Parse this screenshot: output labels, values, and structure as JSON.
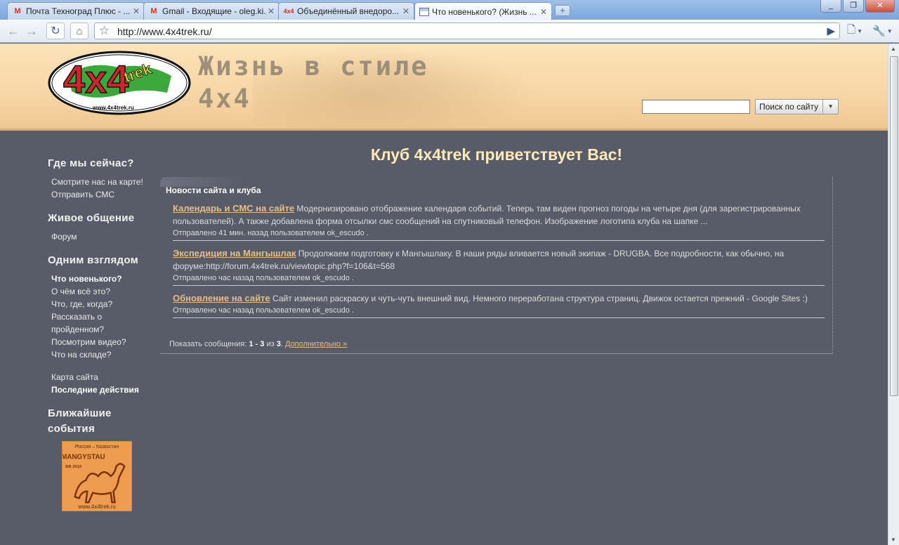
{
  "browser": {
    "tabs": [
      {
        "title": "Почта Техноград Плюс - ...",
        "icon": "gmail-icon"
      },
      {
        "title": "Gmail - Входящие - oleg.ki...",
        "icon": "gmail-icon"
      },
      {
        "title": "Объединённый внедоро...",
        "icon": "4x4trek-favicon"
      },
      {
        "title": "Что новенького? (Жизнь ...",
        "icon": "google-sites-icon"
      }
    ],
    "new_tab": "+",
    "url": "http://www.4x4trek.ru/"
  },
  "header": {
    "tagline_line1": "Жизнь в стиле",
    "tagline_line2": "4x4",
    "logo_text": "4x4trek",
    "logo_url": "www.4x4trek.ru",
    "search_button": "Поиск по сайту",
    "search_value": ""
  },
  "sidebar": {
    "sections": [
      {
        "title": "Где мы сейчас?",
        "items": [
          {
            "label": "Смотрите нас на карте!",
            "bold": false
          },
          {
            "label": "Отправить СМС",
            "bold": false
          }
        ]
      },
      {
        "title": "Живое общение",
        "items": [
          {
            "label": "Форум",
            "bold": false
          }
        ]
      },
      {
        "title": "Одним взглядом",
        "items": [
          {
            "label": "Что новенького?",
            "bold": true
          },
          {
            "label": "О чём всё это?",
            "bold": false
          },
          {
            "label": "Что, где, когда?",
            "bold": false
          },
          {
            "label": "Рассказать о пройденном?",
            "bold": false
          },
          {
            "label": "Посмотрим видео?",
            "bold": false
          },
          {
            "label": "Что на складе?",
            "bold": false
          }
        ]
      },
      {
        "title": "",
        "items": [
          {
            "label": "Карта сайта",
            "bold": false
          },
          {
            "label": "Последние действия",
            "bold": true
          }
        ]
      }
    ],
    "events_title": "Ближайшие события",
    "event_banner": {
      "line1": "Россия – Казахстан",
      "line2": "MANGYSTAU",
      "line3": "БВ 2010",
      "line4": "www.4x4trek.ru"
    }
  },
  "main": {
    "title": "Клуб 4x4trek приветствует Вас!",
    "news_heading": "Новости сайта и клуба",
    "news": [
      {
        "title": "Календарь и СМС на сайте",
        "body": "Модернизировано отображение календаря событий. Теперь там виден прогноз погоды на четыре дня (для зарегистрированных пользователей). А также добавлена форма отсылки смс сообщений на спутниковый телефон. Изображение логотипа клуба на шапке ...",
        "meta": "Отправлено 41 мин. назад пользователем ok_escudo ."
      },
      {
        "title": "Экспедиция на Мангышлак",
        "body": "Продолжаем подготовку к Мангышлаку. В наши ряды вливается новый экипаж - DRUGBA. Все подробности, как обычно, на форуме:http://forum.4x4trek.ru/viewtopic.php?f=106&t=568",
        "meta": "Отправлено час назад пользователем ok_escudo ."
      },
      {
        "title": "Обновление на сайте",
        "body": "Сайт изменил раскраску и чуть-чуть внешний вид. Немного переработана структура страниц. Движок остается прежний - Google Sites :)",
        "meta": "Отправлено час назад пользователем ok_escudo ."
      }
    ],
    "pager": {
      "prefix": "Показать сообщения:",
      "from": "1",
      "dash": "-",
      "to": "3",
      "of": "из",
      "total": "3",
      "dot": ".",
      "more": "Дополнительно »"
    }
  }
}
